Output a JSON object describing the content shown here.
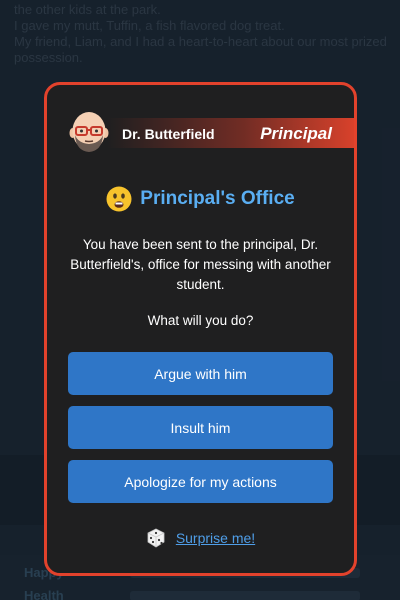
{
  "background": {
    "lines": [
      "the other kids at the park.",
      "I gave my mutt, Tuffin, a fish flavored dog treat.",
      "My friend, Liam, and I had a heart-to-heart about our most prized",
      "possession."
    ],
    "stat_labels": [
      "Happy",
      "Health"
    ]
  },
  "modal": {
    "person_name": "Dr. Butterfield",
    "role": "Principal",
    "title": "Principal's Office",
    "message": "You have been sent to the principal, Dr. Butterfield's, office for messing with another student.",
    "question": "What will you do?",
    "options": [
      {
        "label": "Argue with him"
      },
      {
        "label": "Insult him"
      },
      {
        "label": "Apologize for my actions"
      }
    ],
    "surprise_label": "Surprise me!"
  },
  "colors": {
    "accent_border": "#e2422c",
    "title_blue": "#5aaef2",
    "button_blue": "#2f76c7",
    "link_blue": "#4f9ee8"
  },
  "icons": {
    "avatar": "bald-man-with-glasses-avatar",
    "title_emoji": "grimacing-face-emoji",
    "surprise": "dice-icon"
  }
}
